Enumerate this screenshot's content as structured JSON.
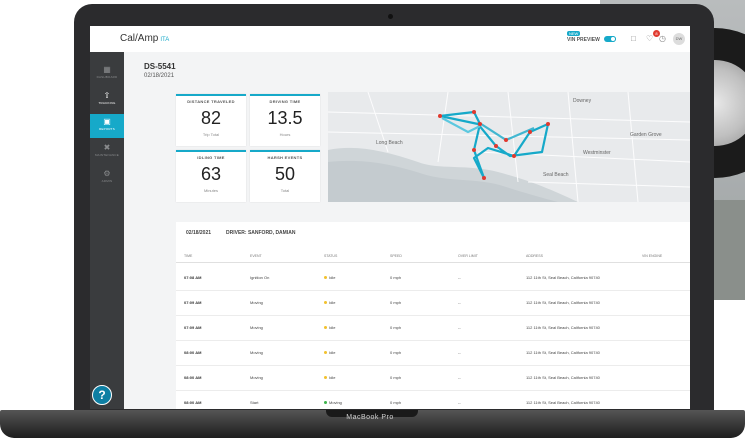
{
  "app": {
    "logo_main": "Cal/Amp",
    "logo_sub": "ITA",
    "preview_tag": "NEW",
    "preview_label": "VIN PREVIEW",
    "avatar_initials": "DW"
  },
  "sidebar": {
    "items": [
      {
        "label": "DASHBOARD",
        "icon": "grid-icon"
      },
      {
        "label": "TRACKING",
        "icon": "arrow-up-icon"
      },
      {
        "label": "REPORTS",
        "icon": "car-icon"
      },
      {
        "label": "MAINTENANCE",
        "icon": "tools-icon"
      },
      {
        "label": "ADMIN",
        "icon": "gear-icon"
      }
    ],
    "help_label": "?"
  },
  "trip": {
    "id": "DS-5541",
    "date": "02/18/2021"
  },
  "stats": [
    {
      "title": "DISTANCE TRAVELED",
      "value": "82",
      "unit": "Trip Total"
    },
    {
      "title": "DRIVING TIME",
      "value": "13.5",
      "unit": "Hours"
    },
    {
      "title": "IDLING TIME",
      "value": "63",
      "unit": "Minutes"
    },
    {
      "title": "HARSH EVENTS",
      "value": "50",
      "unit": "Total"
    }
  ],
  "map": {
    "labels": [
      "Long Beach",
      "Garden Grove",
      "Downey",
      "Westminster",
      "Seal Beach"
    ],
    "route_color": "#16a9c9",
    "stop_color": "#e03a2f"
  },
  "log": {
    "date": "02/18/2021",
    "driver": "DRIVER: SANFORD, DAMIAN",
    "columns": [
      "TIME",
      "EVENT",
      "STATUS",
      "SPEED",
      "OVER LIMIT",
      "ADDRESS",
      "VIN ENGINE"
    ],
    "rows": [
      {
        "time": "07:08 AM",
        "event": "Ignition On",
        "status": "Idle",
        "status_color": "#f2c12e",
        "speed": "0 mph",
        "over": "--",
        "address": "112 11th St, Seal Beach, California 90740"
      },
      {
        "time": "07:09 AM",
        "event": "Moving",
        "status": "Idle",
        "status_color": "#f2c12e",
        "speed": "0 mph",
        "over": "--",
        "address": "112 11th St, Seal Beach, California 90740"
      },
      {
        "time": "07:09 AM",
        "event": "Moving",
        "status": "Idle",
        "status_color": "#f2c12e",
        "speed": "0 mph",
        "over": "--",
        "address": "112 11th St, Seal Beach, California 90740"
      },
      {
        "time": "08:00 AM",
        "event": "Moving",
        "status": "Idle",
        "status_color": "#f2c12e",
        "speed": "0 mph",
        "over": "--",
        "address": "112 11th St, Seal Beach, California 90740"
      },
      {
        "time": "08:00 AM",
        "event": "Moving",
        "status": "Idle",
        "status_color": "#f2c12e",
        "speed": "0 mph",
        "over": "--",
        "address": "112 11th St, Seal Beach, California 90740"
      },
      {
        "time": "08:00 AM",
        "event": "Start",
        "status": "Moving",
        "status_color": "#3cb34a",
        "speed": "0 mph",
        "over": "--",
        "address": "112 11th St, Seal Beach, California 90740"
      }
    ]
  },
  "device": {
    "brand": "MacBook Pro"
  }
}
